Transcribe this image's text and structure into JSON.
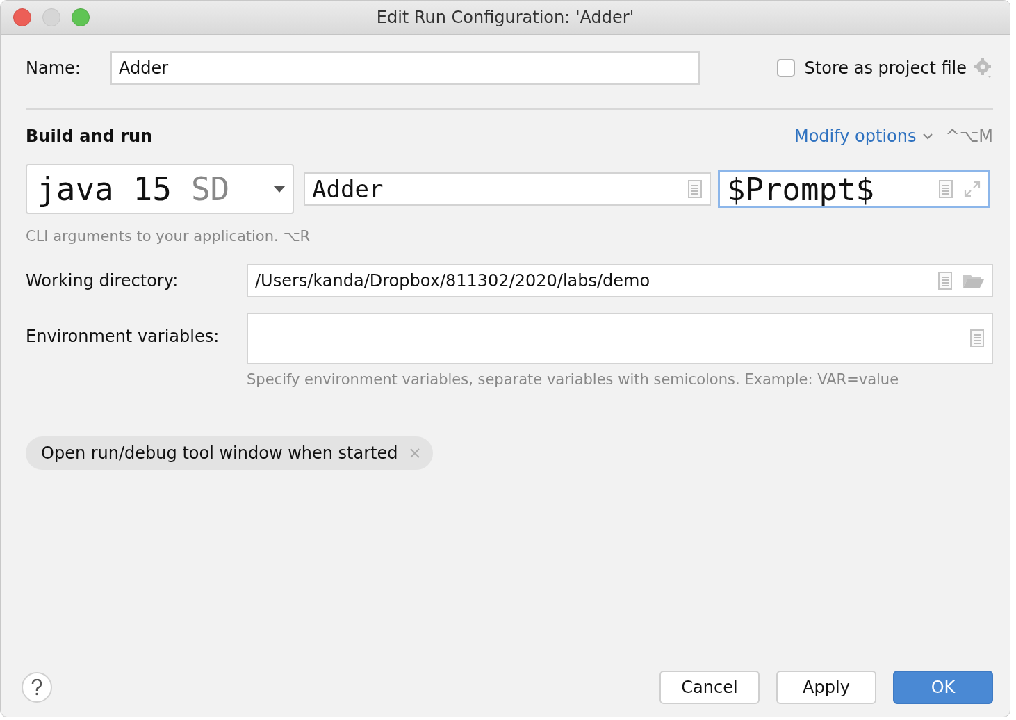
{
  "window": {
    "title": "Edit Run Configuration: 'Adder'"
  },
  "name_field": {
    "label": "Name:",
    "value": "Adder"
  },
  "store_as_project_file": {
    "label": "Store as project file",
    "checked": false
  },
  "section": {
    "title": "Build and run",
    "modify_options": "Modify options",
    "shortcut": "^⌥M"
  },
  "jdk_dropdown": {
    "value": "java 15",
    "suffix": "SD"
  },
  "main_class_field": {
    "value": "Adder"
  },
  "program_arguments_field": {
    "value": "$Prompt$",
    "focused": true
  },
  "arguments_hint": "CLI arguments to your application. ⌥R",
  "working_directory": {
    "label": "Working directory:",
    "value": "/Users/kanda/Dropbox/811302/2020/labs/demo"
  },
  "environment_variables": {
    "label": "Environment variables:",
    "hint": "Specify environment variables, separate variables with semicolons. Example: VAR=value"
  },
  "option_tags": [
    {
      "label": "Open run/debug tool window when started"
    }
  ],
  "buttons": [
    {
      "label": "Cancel",
      "default": false
    },
    {
      "label": "Apply",
      "default": false
    },
    {
      "label": "OK",
      "default": true
    }
  ]
}
